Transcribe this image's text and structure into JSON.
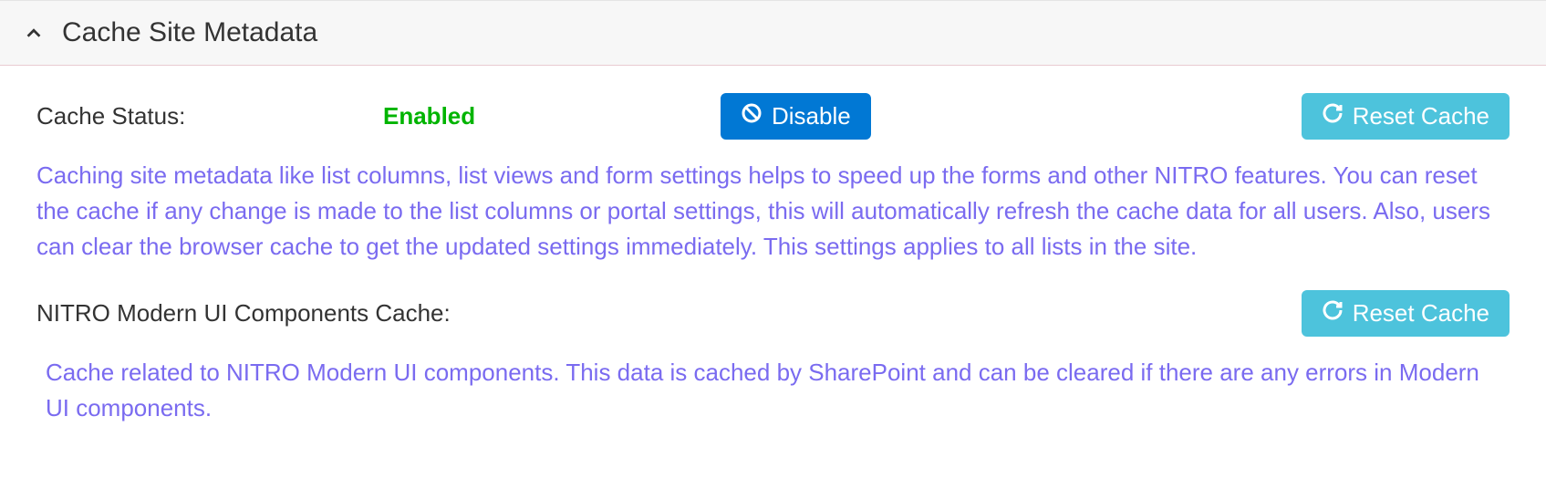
{
  "header": {
    "title": "Cache Site Metadata"
  },
  "cacheStatus": {
    "label": "Cache Status:",
    "value": "Enabled",
    "disableButton": "Disable",
    "resetButton": "Reset Cache",
    "description": "Caching site metadata like list columns, list views and form settings helps to speed up the forms and other NITRO features. You can reset the cache if any change is made to the list columns or portal settings, this will automatically refresh the cache data for all users. Also, users can clear the browser cache to get the updated settings immediately. This settings applies to all lists in the site."
  },
  "modernUI": {
    "label": "NITRO Modern UI Components Cache:",
    "resetButton": "Reset Cache",
    "description": "Cache related to NITRO Modern UI components. This data is cached by SharePoint and can be cleared if there are any errors in Modern UI components."
  }
}
